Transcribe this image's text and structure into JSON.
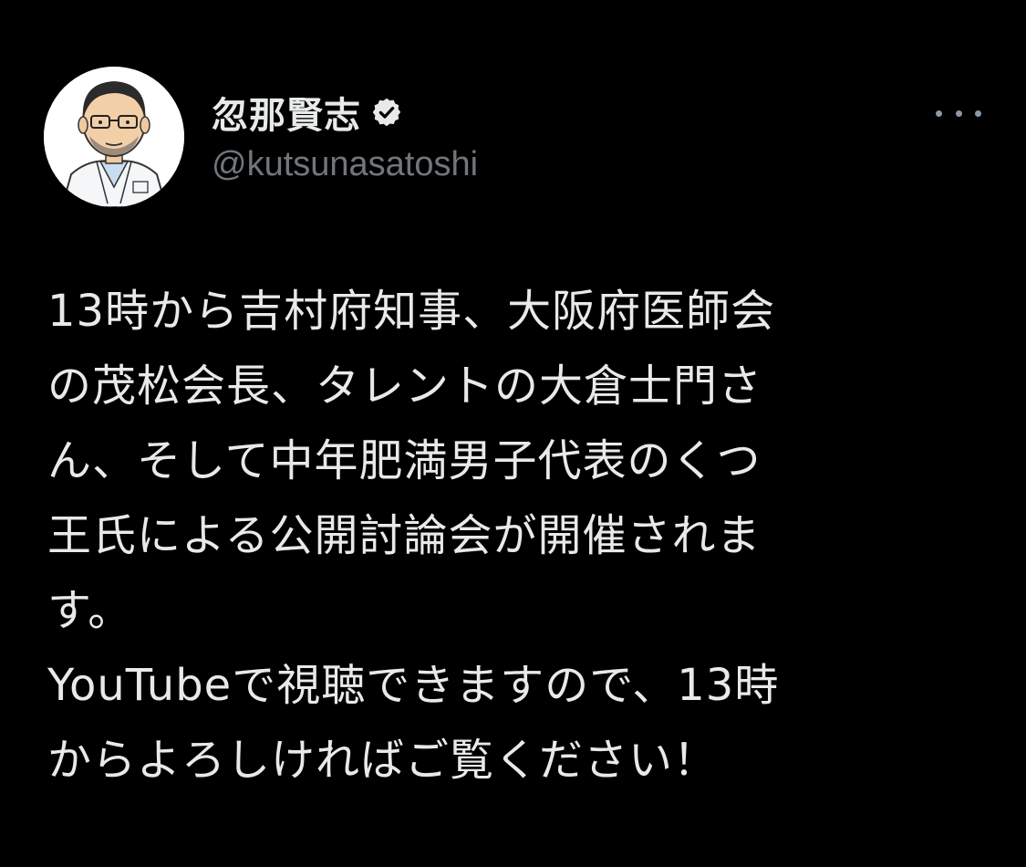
{
  "author": {
    "display_name": "忽那賢志",
    "handle": "@kutsunasatoshi",
    "verified": true
  },
  "tweet": {
    "lines": [
      "13時から吉村府知事、大阪府医師会",
      "の茂松会長、タレントの大倉士門さ",
      "ん、そして中年肥満男子代表のくつ",
      "王氏による公開討論会が開催されま",
      "す。",
      "YouTubeで視聴できますので、13時",
      "からよろしければご覧ください！"
    ]
  },
  "icons": {
    "verified": "verified-badge-icon",
    "more": "more-options-icon"
  },
  "colors": {
    "background": "#000000",
    "text_primary": "#e7e9ea",
    "text_secondary": "#71767b"
  }
}
